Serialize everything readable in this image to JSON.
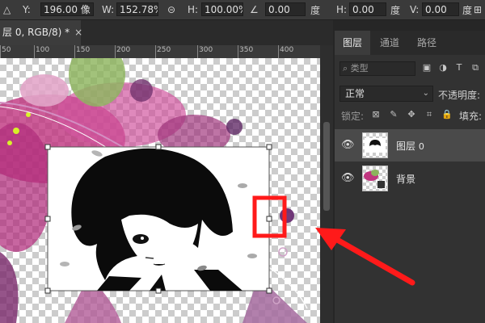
{
  "options_bar": {
    "x_value": "196.00 像",
    "w_label": "W:",
    "w_value": "152.78%",
    "h_label": "H:",
    "h_value": "100.00%",
    "angle_value": "0.00",
    "angle_unit": "度",
    "h_skew_label": "H:",
    "h_skew_value": "0.00",
    "h_skew_unit": "度",
    "v_skew_label": "V:",
    "v_skew_value": "0.00",
    "v_skew_unit": "度"
  },
  "document_tab": {
    "title": "层 0, RGB/8) *",
    "close": "×"
  },
  "ruler": {
    "labels": [
      "50",
      "100",
      "150",
      "200",
      "250",
      "300",
      "350",
      "400"
    ]
  },
  "layers_panel": {
    "tabs": [
      "图层",
      "通道",
      "路径"
    ],
    "active_tab": 0,
    "filter_placeholder": "类型",
    "blend_mode": "正常",
    "opacity_label": "不透明度:",
    "lock_label": "锁定:",
    "fill_label": "填充:",
    "layers": [
      {
        "name": "图层",
        "suffix": "0",
        "selected": true
      },
      {
        "name": "背景",
        "suffix": "",
        "selected": false
      }
    ]
  },
  "colors": {
    "annotation_red": "#ff1a1a",
    "panel_bg": "#323232",
    "selected_layer": "#4a4a4a"
  }
}
